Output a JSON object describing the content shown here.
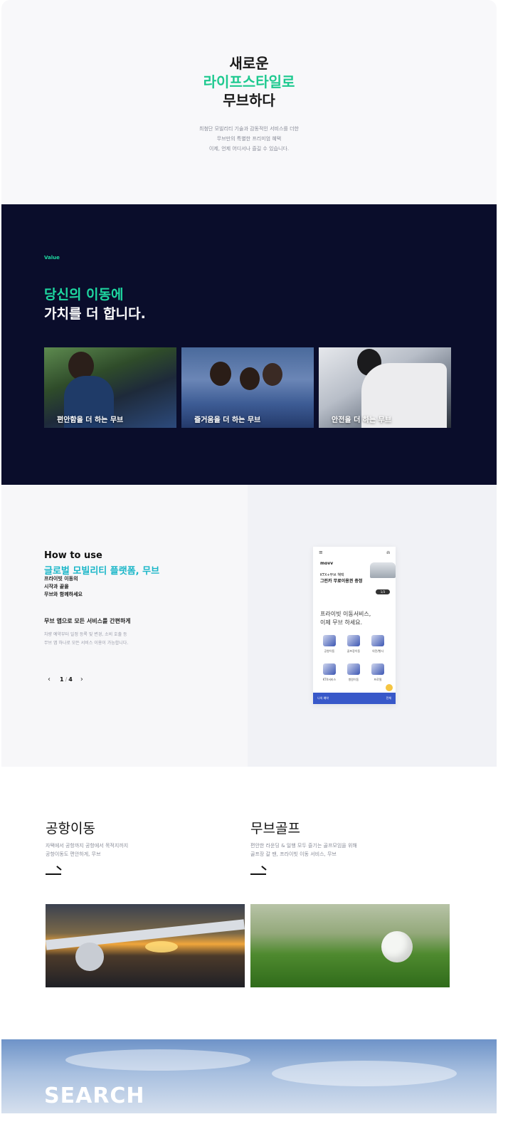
{
  "hero": {
    "line1": "새로운",
    "line2": "라이프스타일로",
    "line3": "무브하다",
    "desc1": "최첨단 모빌리티 기술과 감동적인 서비스를 더한",
    "desc2": "무브만의 특별한 프리미엄 혜택",
    "desc3": "이제, 언제 어디서나 즐길 수 있습니다."
  },
  "value": {
    "tag": "Value",
    "title1": "당신의 이동에",
    "title2": "가치를 더 합니다.",
    "cards": [
      {
        "caption": "편안함을 더 하는 무브"
      },
      {
        "caption": "즐거움을 더 하는 무브"
      },
      {
        "caption": "안전을 더 하는 무브"
      }
    ]
  },
  "how": {
    "title": "How to use",
    "subtitle": "글로벌 모빌리티 플랫폼, 무브",
    "para1": "프라이빗 이동의",
    "para2": "시작과 끝을",
    "para3": "무브와 함께하세요",
    "step_title": "무브 앱으로 모든 서비스를 간편하게",
    "step_desc1": "차량 예약부터 일정 등록 및 변경, 소비 호출 등",
    "step_desc2": "무브 앱 하나로 모든 서비스 이용이 가능합니다.",
    "pager": {
      "current": "1",
      "separator": "/",
      "total": "4"
    },
    "phone": {
      "logo": "movv",
      "promo1": "KTX+무브 혜택",
      "promo2": "그린카 무료이용권 증정",
      "slider": "1/3",
      "headline1": "프라이빗 이동서비스,",
      "headline2": "이제 무브 하세요.",
      "grid": [
        "공항이동",
        "골프장이동",
        "의전/행사",
        "KTX서비스",
        "병원이동",
        "프로필"
      ],
      "bottom_left": "나의 예약",
      "bottom_right": "전체"
    }
  },
  "services": [
    {
      "title": "공항이동",
      "desc1": "자택에서 공항까지 공항에서 목적지까지",
      "desc2": "공항이동도 편안하게, 무브"
    },
    {
      "title": "무브골프",
      "desc1": "편안한 라운딩 & 일행 모두 즐기는 골프모임을 위해",
      "desc2": "골프장 갈 땐, 프라이빗 이동 서비스, 무브"
    }
  ],
  "search": {
    "label": "SEARCH"
  },
  "colors": {
    "accent_green": "#1ec98f",
    "accent_teal": "#19b6c8",
    "navy": "#0a0d2b",
    "app_blue": "#3858c9"
  }
}
